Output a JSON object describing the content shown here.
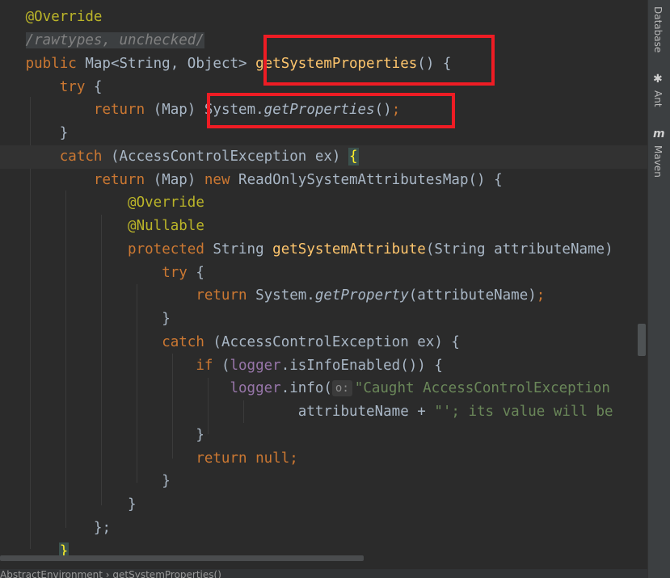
{
  "code": {
    "l1_annotation": "@Override",
    "l2_suppress_comment": "/rawtypes, unchecked/",
    "l3_public": "public",
    "l3_type": " Map<String, Object> ",
    "l3_method": "getSystemProperties",
    "l3_tail": "() {",
    "l4_try": "try",
    "l4_tail": " {",
    "l5_return": "return",
    "l5_cast": " (Map) ",
    "l5_system": "System.",
    "l5_call": "getProperties",
    "l5_parens": "()",
    "l5_semi": ";",
    "l6_close": "}",
    "l7_catch": "catch",
    "l7_args": " (AccessControlException ex) ",
    "l7_brace": "{",
    "l8_return": "return",
    "l8_cast": " (Map) ",
    "l8_new": "new",
    "l8_class": " ReadOnlySystemAttributesMap() {",
    "l9_annotation": "@Override",
    "l10_annotation": "@Nullable",
    "l11_protected": "protected",
    "l11_type": " String ",
    "l11_method": "getSystemAttribute",
    "l11_params": "(String attributeName)",
    "l12_try": "try",
    "l12_tail": " {",
    "l13_return": "return",
    "l13_system": " System.",
    "l13_call": "getProperty",
    "l13_args": "(attributeName)",
    "l13_semi": ";",
    "l14_close": "}",
    "l15_catch": "catch",
    "l15_args": " (AccessControlException ex) {",
    "l16_if": "if",
    "l16_open": " (",
    "l16_logger": "logger",
    "l16_tail": ".isInfoEnabled()) {",
    "l17_logger": "logger",
    "l17_call": ".info(",
    "l17_hint": "o:",
    "l17_string": "\"Caught AccessControlException",
    "l18_arg": "attributeName + ",
    "l18_string": "\"'; its value will be",
    "l19_close": "}",
    "l20_return": "return",
    "l20_null": " null",
    "l20_semi": ";",
    "l21_close": "}",
    "l22_close": "}",
    "l23_close": "};",
    "l24_close": "}"
  },
  "breadcrumb": {
    "path": "AbstractEnvironment  ›  getSystemProperties()"
  },
  "tool_windows": [
    {
      "label": "Database",
      "icon": "database-icon"
    },
    {
      "label": "Ant",
      "icon": "ant-icon"
    },
    {
      "label": "Maven",
      "icon": "maven-icon"
    }
  ],
  "colors": {
    "background": "#2b2b2b",
    "keyword": "#cc7832",
    "annotation": "#bbb529",
    "method_declaration": "#ffc66d",
    "field": "#9876aa",
    "string": "#6a8759",
    "highlight_box": "#ee1c24"
  }
}
